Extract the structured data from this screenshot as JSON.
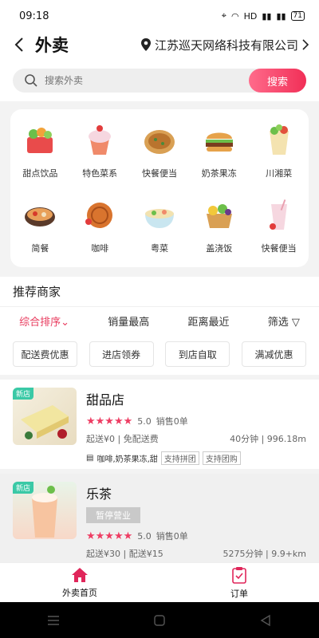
{
  "status": {
    "time": "09:18",
    "network": "HD",
    "battery": "71"
  },
  "header": {
    "title": "外卖",
    "location": "江苏巡天网络科技有限公司"
  },
  "search": {
    "placeholder": "搜索外卖",
    "button": "搜索"
  },
  "categories": [
    {
      "label": "甜点饮品",
      "icon": "basket-icon"
    },
    {
      "label": "特色菜系",
      "icon": "cupcake-icon"
    },
    {
      "label": "快餐便当",
      "icon": "pancake-icon"
    },
    {
      "label": "奶茶果冻",
      "icon": "burger-icon"
    },
    {
      "label": "川湘菜",
      "icon": "wrap-icon"
    },
    {
      "label": "简餐",
      "icon": "hotpot-icon"
    },
    {
      "label": "咖啡",
      "icon": "mooncake-icon"
    },
    {
      "label": "粤菜",
      "icon": "noodle-icon"
    },
    {
      "label": "盖浇饭",
      "icon": "fruit-basket-icon"
    },
    {
      "label": "快餐便当",
      "icon": "drink-icon"
    }
  ],
  "section_title": "推荐商家",
  "sorts": {
    "s0": "综合排序",
    "s1": "销量最高",
    "s2": "距离最近",
    "s3": "筛选"
  },
  "filters": [
    "配送费优惠",
    "进店领券",
    "到店自取",
    "满减优惠"
  ],
  "shops": [
    {
      "badge": "新店",
      "name": "甜品店",
      "stars": "★★★★★",
      "rating": "5.0",
      "sales": "销售0单",
      "fee": "起送¥0 | 免配送费",
      "distance": "40分钟 | 996.18m",
      "tags": "咖啡,奶茶果冻,甜",
      "pill1": "支持拼团",
      "pill2": "支持团购"
    },
    {
      "badge": "新店",
      "name": "乐茶",
      "closed": "暂停营业",
      "stars": "★★★★★",
      "rating": "5.0",
      "sales": "销售0单",
      "fee": "起送¥30 | 配送¥15",
      "distance": "5275分钟 | 9.9+km"
    }
  ],
  "tabs": {
    "home": "外卖首页",
    "orders": "订单"
  },
  "colors": {
    "accent": "#f12f57",
    "badge": "#3ac9a6"
  }
}
